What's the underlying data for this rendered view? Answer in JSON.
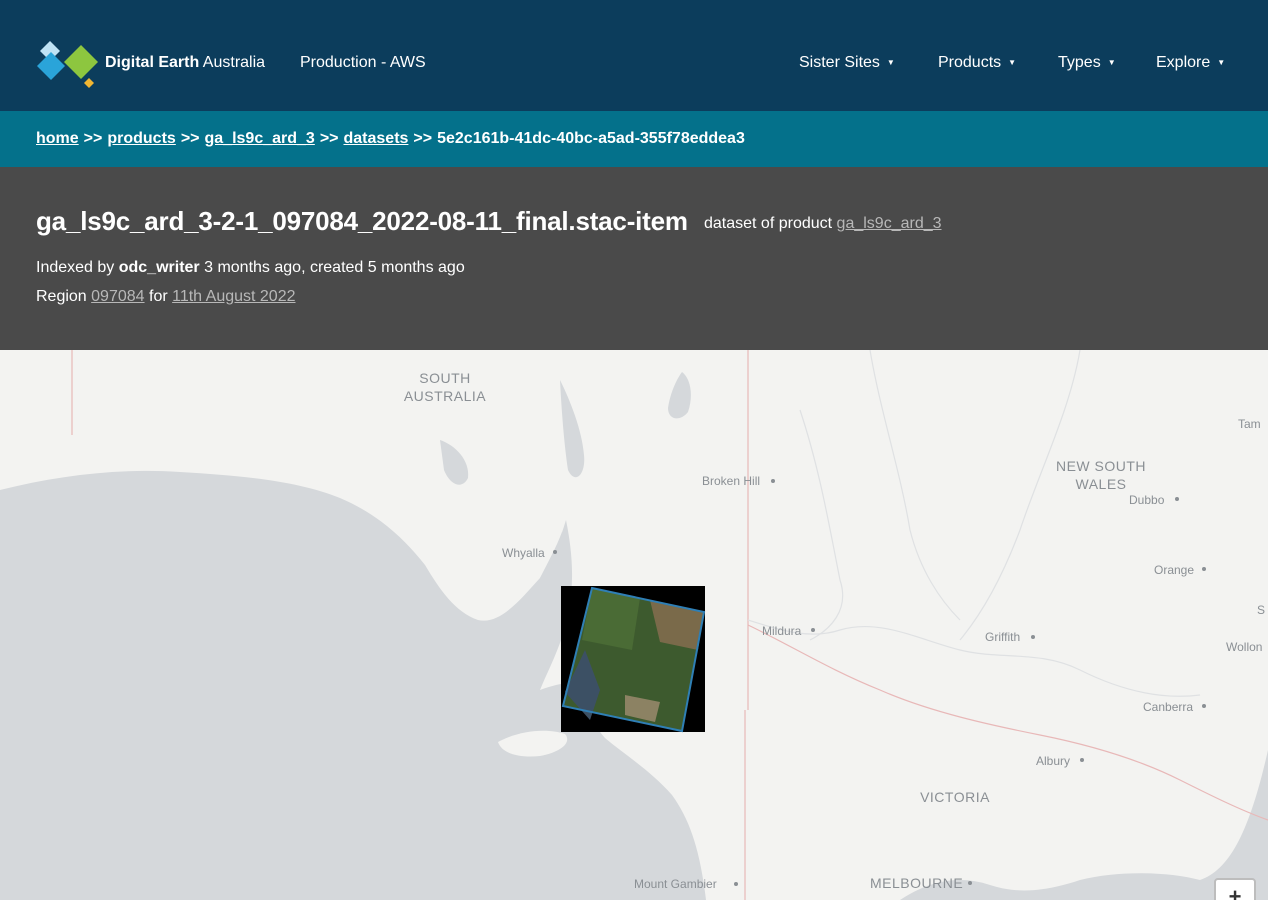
{
  "header": {
    "brand_bold": "Digital Earth",
    "brand_regular": "Australia",
    "environment": "Production - AWS",
    "nav": [
      {
        "label": "Sister Sites"
      },
      {
        "label": "Products"
      },
      {
        "label": "Types"
      },
      {
        "label": "Explore"
      }
    ],
    "caret": "▼"
  },
  "breadcrumb": {
    "home": "home",
    "products": "products",
    "product": "ga_ls9c_ard_3",
    "datasets": "datasets",
    "separator": ">>",
    "current": "5e2c161b-41dc-40bc-a5ad-355f78eddea3"
  },
  "dataset": {
    "title": "ga_ls9c_ard_3-2-1_097084_2022-08-11_final.stac-item",
    "subtitle_prefix": "dataset of product",
    "product_link": "ga_ls9c_ard_3",
    "indexed_prefix": "Indexed by",
    "indexed_by": "odc_writer",
    "indexed_suffix": "3 months ago, created 5 months ago",
    "region_prefix": "Region",
    "region": "097084",
    "date_prefix": "for",
    "date": "11th August 2022"
  },
  "map": {
    "labels": {
      "south_australia_1": "SOUTH",
      "south_australia_2": "AUSTRALIA",
      "nsw_1": "NEW SOUTH",
      "nsw_2": "WALES",
      "victoria": "VICTORIA",
      "tam": "Tam",
      "s": "S",
      "wollon": "Wollon"
    },
    "cities": [
      {
        "name": "Broken Hill"
      },
      {
        "name": "Dubbo"
      },
      {
        "name": "Whyalla"
      },
      {
        "name": "Orange"
      },
      {
        "name": "Mildura"
      },
      {
        "name": "Griffith"
      },
      {
        "name": "Canberra"
      },
      {
        "name": "Albury"
      },
      {
        "name": "Mount Gambier"
      },
      {
        "name": "MELBOURNE"
      }
    ],
    "zoom_in": "+",
    "colors": {
      "sea": "#d5d8db",
      "land": "#f3f3f1",
      "border": "#e8b8b8",
      "footprint": "#2f7fb5"
    }
  }
}
